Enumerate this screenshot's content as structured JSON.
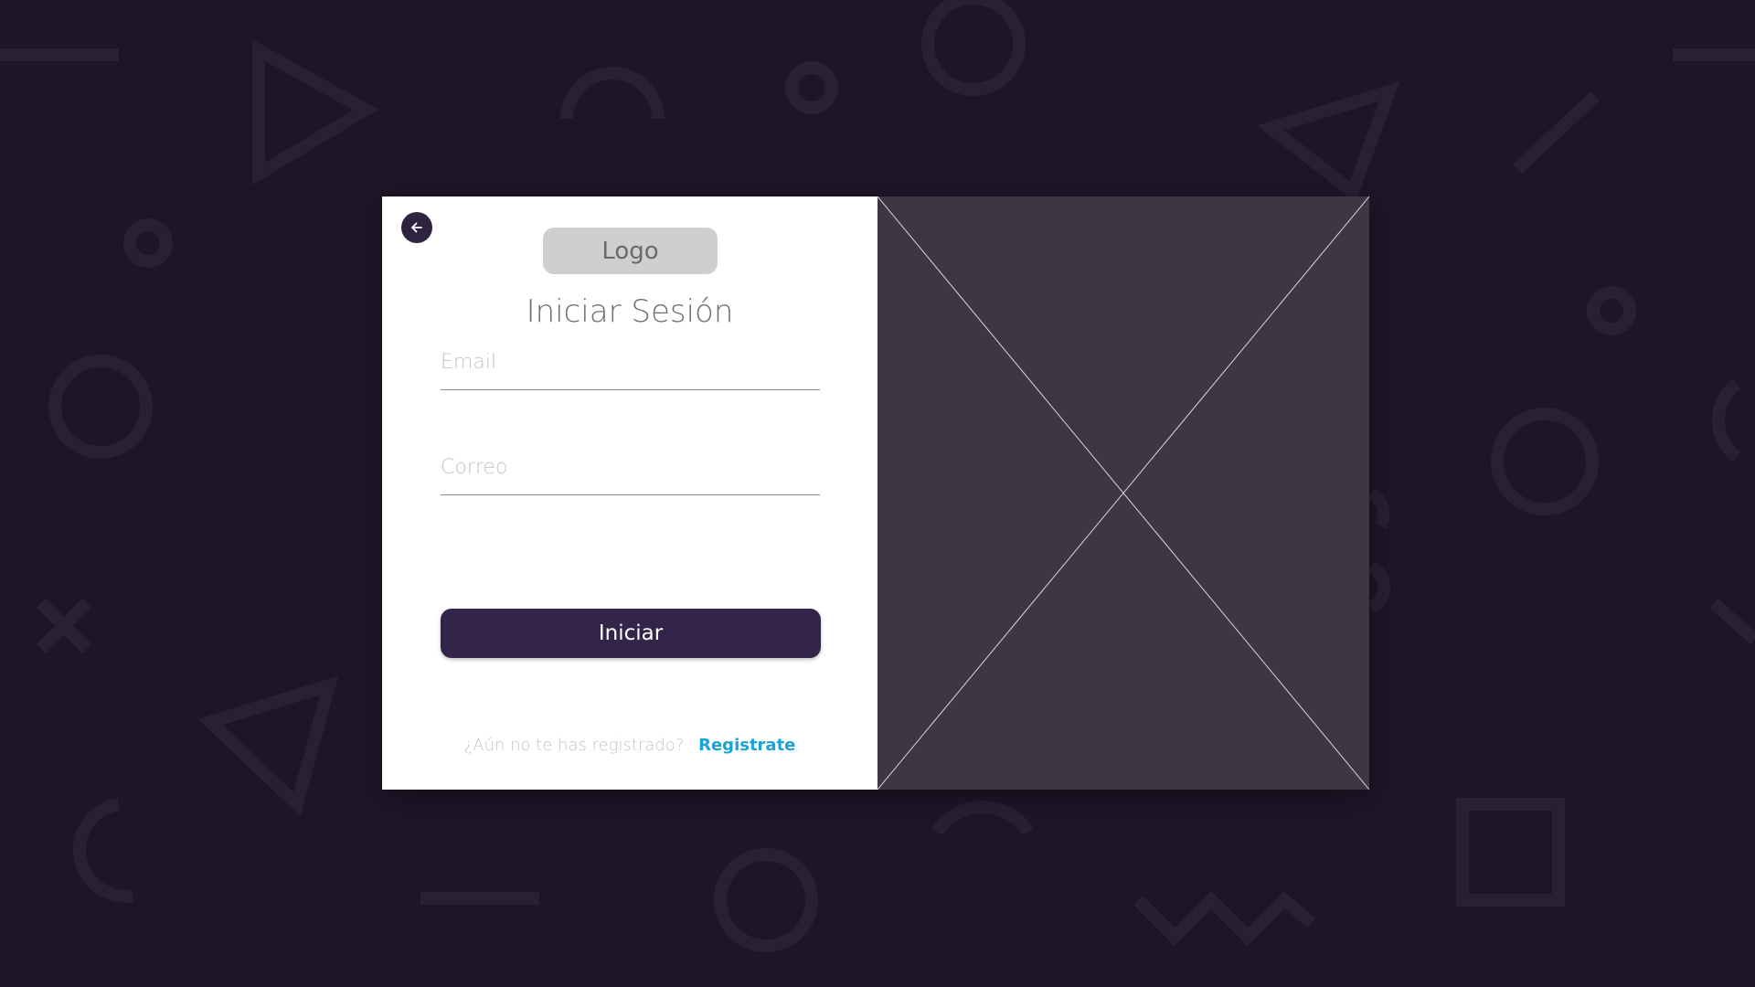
{
  "logo": {
    "text": "Logo"
  },
  "title": "Iniciar Sesión",
  "form": {
    "email": {
      "placeholder": "Email",
      "value": ""
    },
    "correo": {
      "placeholder": "Correo",
      "value": ""
    },
    "submit_label": "Iniciar"
  },
  "footer": {
    "question": "¿Aún no te has registrado?",
    "link": "Registrate"
  },
  "colors": {
    "background": "#1d1628",
    "primary_button": "#33244a",
    "link": "#1aa3d6",
    "image_placeholder": "#3d3744"
  },
  "icons": {
    "back": "arrow-left-icon"
  }
}
